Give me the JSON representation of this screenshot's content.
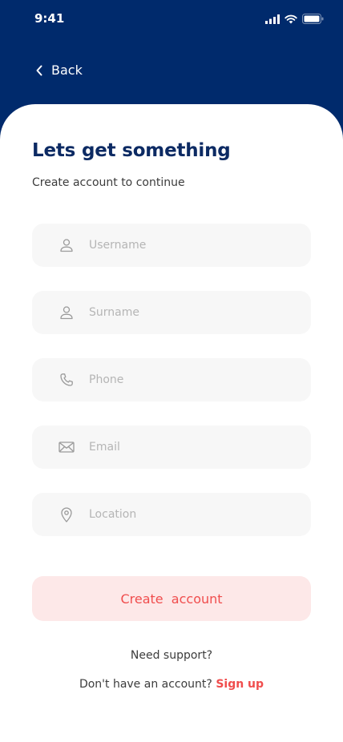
{
  "status_bar": {
    "time": "9:41"
  },
  "nav": {
    "back_label": "Back"
  },
  "form": {
    "title": "Lets get something",
    "subtitle": "Create account to continue",
    "fields": [
      {
        "placeholder": "Username",
        "value": "",
        "icon": "person-icon"
      },
      {
        "placeholder": "Surname",
        "value": "",
        "icon": "person-icon"
      },
      {
        "placeholder": "Phone",
        "value": "",
        "icon": "phone-icon"
      },
      {
        "placeholder": "Email",
        "value": "",
        "icon": "mail-icon"
      },
      {
        "placeholder": "Location",
        "value": "",
        "icon": "location-pin-icon"
      }
    ],
    "submit_label": "Create  account"
  },
  "footer": {
    "support_text": "Need support?",
    "no_account_text": "Don't have an account?",
    "signup_label": "Sign up"
  },
  "colors": {
    "header": "#002a6c",
    "title": "#0c2a63",
    "accent": "#f04d4d",
    "button_bg": "#fde8e8",
    "field_bg": "#f7f7f7"
  }
}
